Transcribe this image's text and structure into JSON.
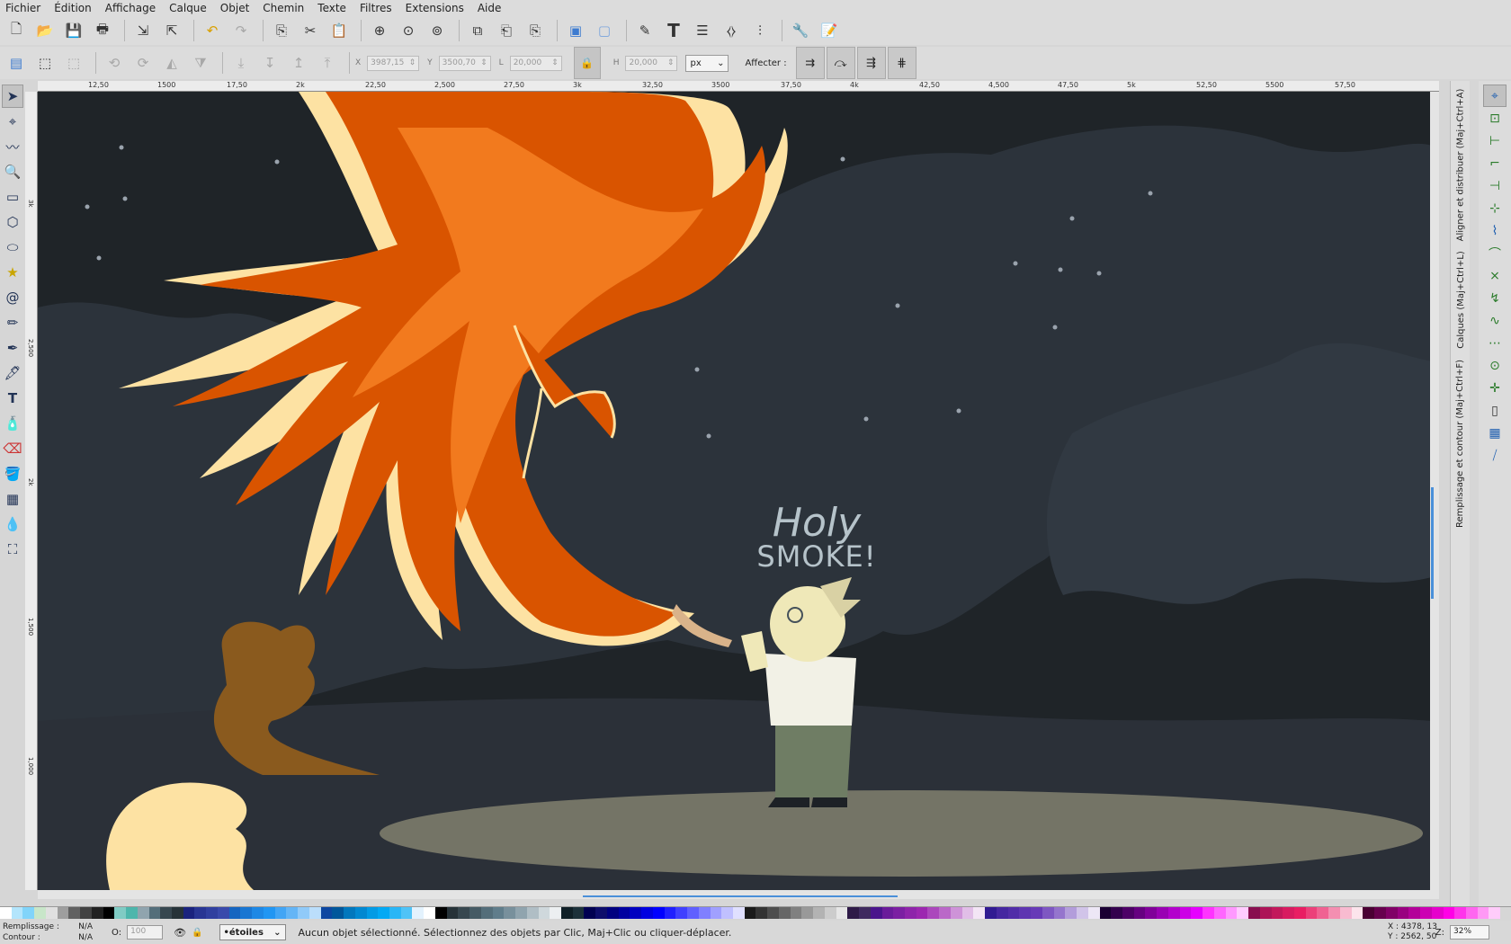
{
  "menu": [
    "Fichier",
    "Édition",
    "Affichage",
    "Calque",
    "Objet",
    "Chemin",
    "Texte",
    "Filtres",
    "Extensions",
    "Aide"
  ],
  "toolbar2": {
    "x_label": "X",
    "x_value": "3987,15",
    "y_label": "Y",
    "y_value": "3500,70",
    "w_label": "L",
    "w_value": "20,000",
    "h_label": "H",
    "h_value": "20,000",
    "unit": "px",
    "affect_label": "Affecter :"
  },
  "ruler": {
    "h_ticks": [
      "12,50",
      "1500",
      "17,50",
      "2k",
      "22,50",
      "2,500",
      "27,50",
      "3k",
      "32,50",
      "3500",
      "37,50",
      "4k",
      "42,50",
      "4,500",
      "47,50",
      "5k",
      "52,50",
      "5500",
      "57,50"
    ],
    "v_ticks": [
      "3k",
      "2,500",
      "2k",
      "1,500",
      "1,000"
    ]
  },
  "canvas": {
    "speech_line1": "Holy",
    "speech_line2": "SMOKE!"
  },
  "dock": {
    "tab_align": "Aligner et distribuer (Maj+Ctrl+A)",
    "tab_layers": "Calques (Maj+Ctrl+L)",
    "tab_fill": "Remplissage et contour (Maj+Ctrl+F)"
  },
  "status": {
    "fill_label": "Remplissage :",
    "fill_value": "N/A",
    "stroke_label": "Contour :",
    "stroke_value": "N/A",
    "opacity_label": "O:",
    "opacity_value": "100",
    "layer": "•étoiles",
    "message": "Aucun objet sélectionné. Sélectionnez des objets par Clic, Maj+Clic ou cliquer-déplacer.",
    "cursor_x": "X : 4378, 13",
    "cursor_y": "Y : 2562, 50",
    "zoom_label": "Z:",
    "zoom_value": "32%"
  },
  "colors": {
    "sky": "#1f2428",
    "cloud": "#2c333b",
    "phoenix_dark": "#d95400",
    "phoenix_mid": "#f27a1e",
    "phoenix_light": "#fde2a3",
    "ground": "#8d8b75",
    "accent": "#4a90d9"
  },
  "palette": [
    "#ffffff",
    "#b3e5fc",
    "#81d4fa",
    "#c8e6c9",
    "#e0e0e0",
    "#9e9e9e",
    "#616161",
    "#424242",
    "#212121",
    "#000000",
    "#80cbc4",
    "#4db6ac",
    "#90a4ae",
    "#546e7a",
    "#37474f",
    "#263238",
    "#1a237e",
    "#283593",
    "#303f9f",
    "#3949ab",
    "#1565c0",
    "#1976d2",
    "#1e88e5",
    "#2196f3",
    "#42a5f5",
    "#64b5f6",
    "#90caf9",
    "#bbdefb",
    "#0d47a1",
    "#01579b",
    "#0277bd",
    "#0288d1",
    "#039be5",
    "#03a9f4",
    "#29b6f6",
    "#4fc3f7",
    "#e3f2fd",
    "#ffffff",
    "#000000",
    "#263238",
    "#37474f",
    "#455a64",
    "#546e7a",
    "#607d8b",
    "#78909c",
    "#90a4ae",
    "#b0bec5",
    "#cfd8dc",
    "#eceff1",
    "#102027",
    "#1c313a",
    "#000051",
    "#0d0d6b",
    "#000080",
    "#0000a0",
    "#0000c0",
    "#0000e0",
    "#0000ff",
    "#2020ff",
    "#4040ff",
    "#6060ff",
    "#8080ff",
    "#a0a0ff",
    "#c0c0ff",
    "#e0e0ff",
    "#1a1a1a",
    "#333333",
    "#4d4d4d",
    "#666666",
    "#808080",
    "#999999",
    "#b3b3b3",
    "#cccccc",
    "#e6e6e6",
    "#2e1a47",
    "#3f2a5f",
    "#4a148c",
    "#6a1b9a",
    "#7b1fa2",
    "#8e24aa",
    "#9c27b0",
    "#ab47bc",
    "#ba68c8",
    "#ce93d8",
    "#e1bee7",
    "#f3e5f5",
    "#311b92",
    "#4527a0",
    "#512da8",
    "#5e35b1",
    "#673ab7",
    "#7e57c2",
    "#9575cd",
    "#b39ddb",
    "#d1c4e9",
    "#ede7f6",
    "#1a0033",
    "#33004d",
    "#4d0066",
    "#660080",
    "#800099",
    "#9900b3",
    "#b300cc",
    "#cc00e6",
    "#e600ff",
    "#ff33ff",
    "#ff66ff",
    "#ff99ff",
    "#ffccff",
    "#880e4f",
    "#ad1457",
    "#c2185b",
    "#d81b60",
    "#e91e63",
    "#ec407a",
    "#f06292",
    "#f48fb1",
    "#f8bbd0",
    "#fce4ec",
    "#4a0033",
    "#66004d",
    "#800066",
    "#990080",
    "#b30099",
    "#cc00b3",
    "#e600cc",
    "#ff00e6",
    "#ff33eb",
    "#ff66f0",
    "#ff99f5",
    "#ffccfa",
    "#d6d6d6"
  ]
}
